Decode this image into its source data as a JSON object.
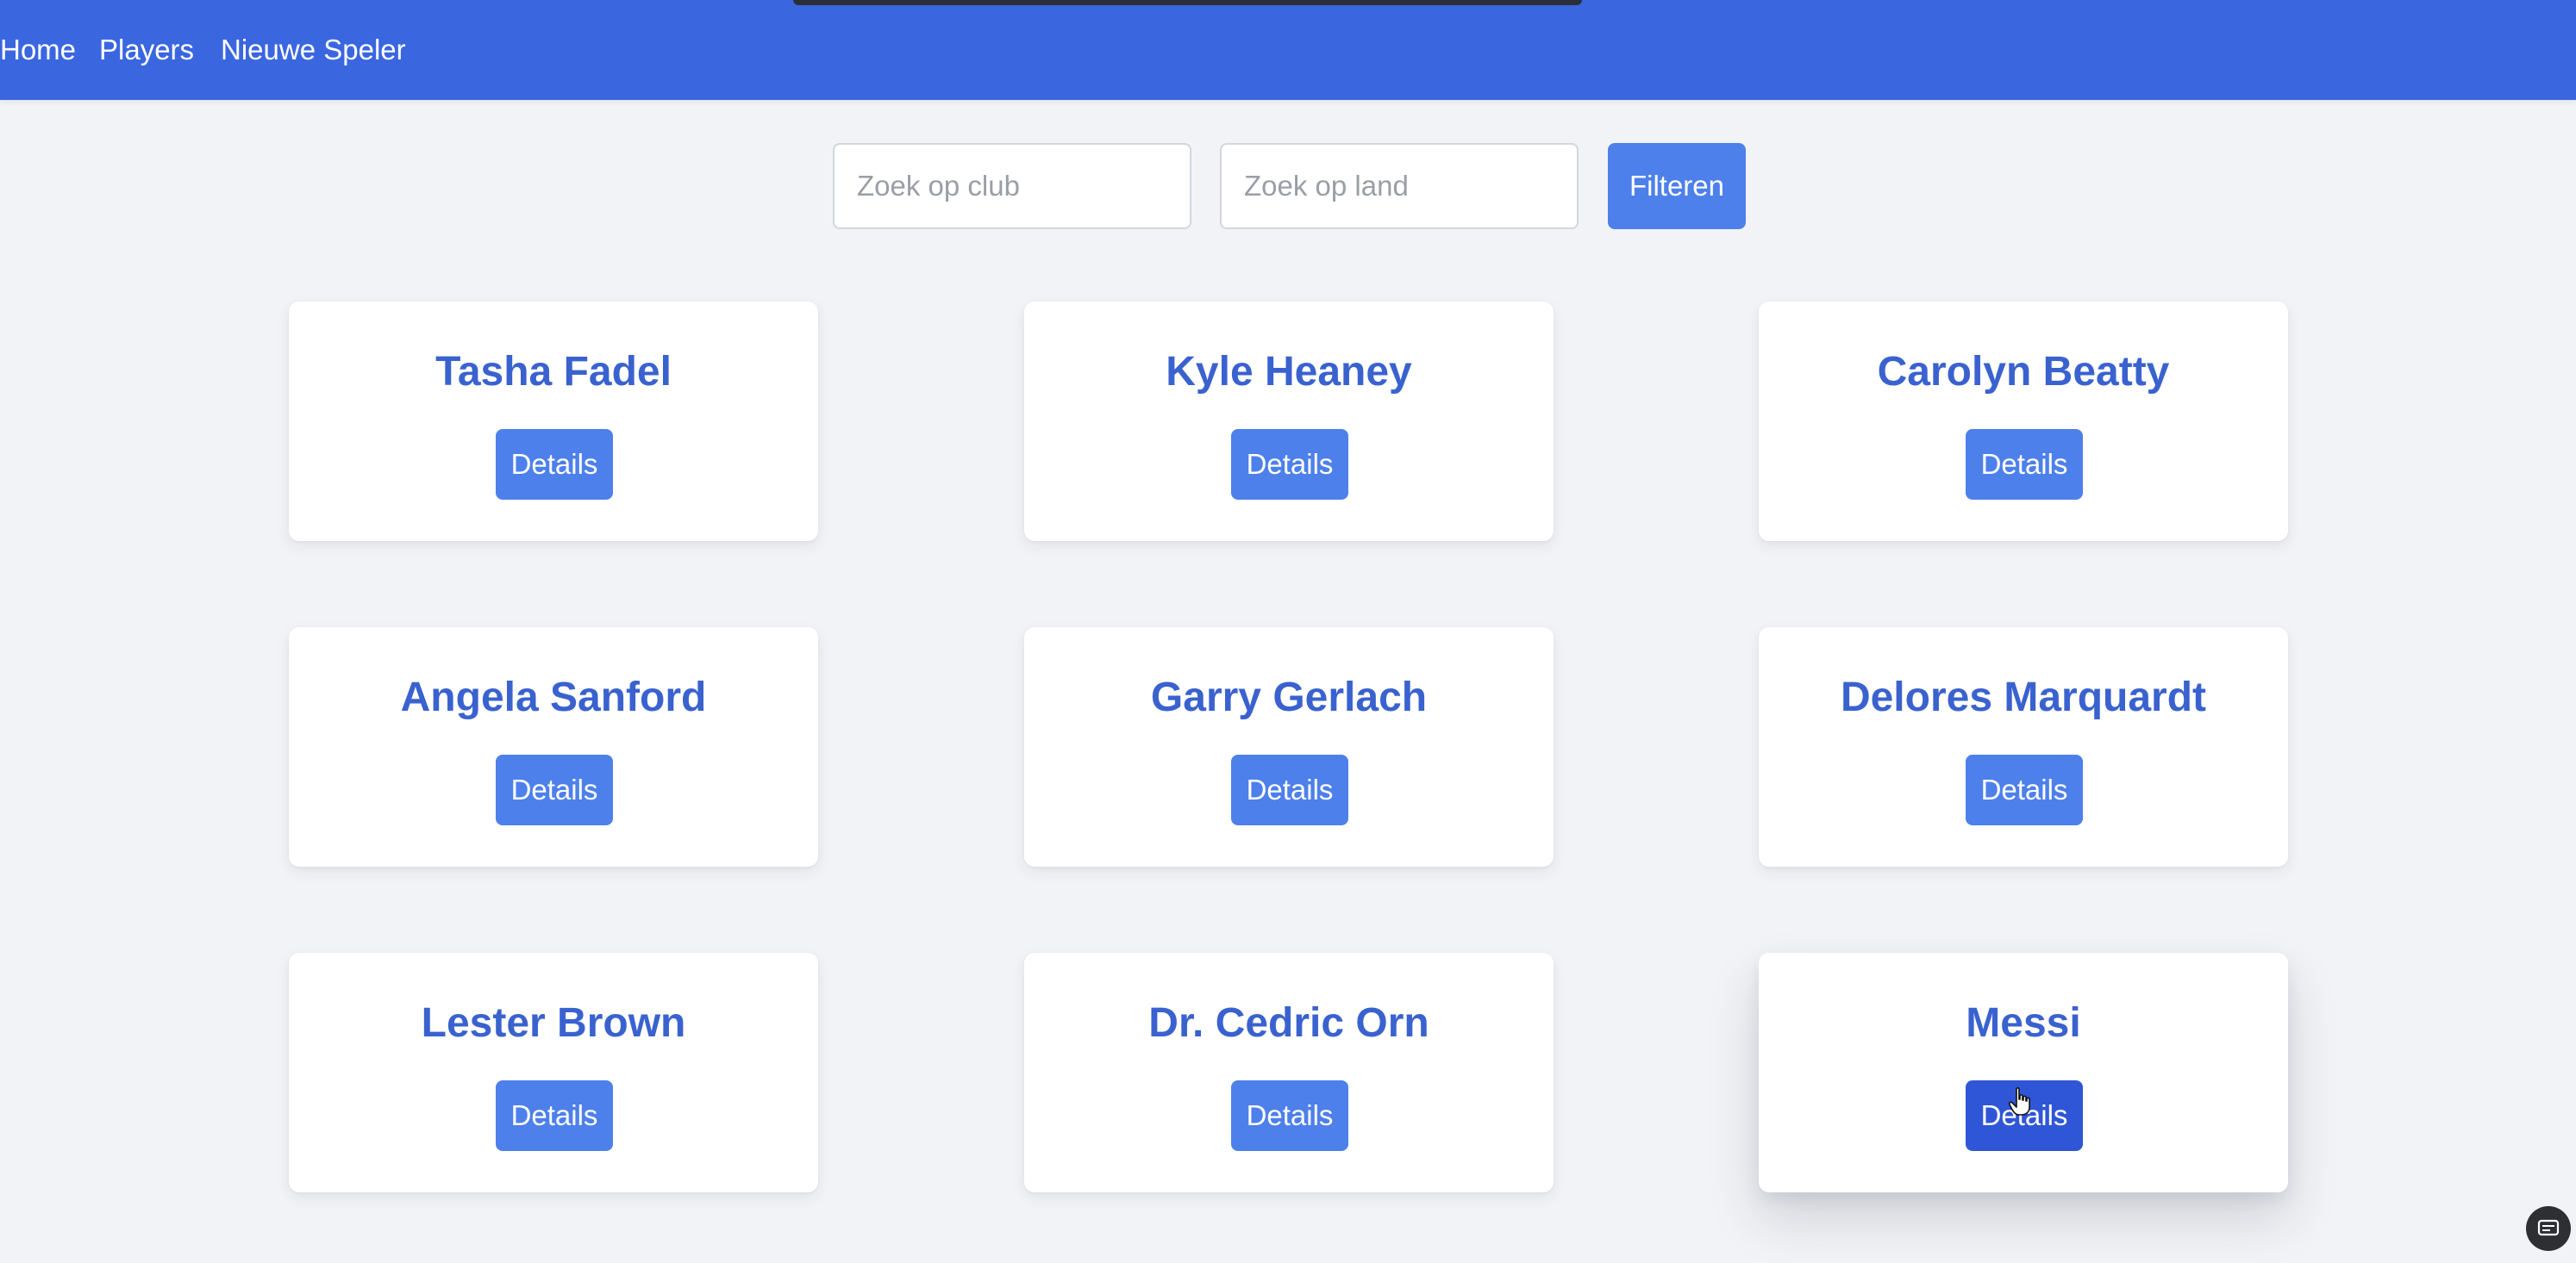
{
  "nav": {
    "links": [
      "Home",
      "Players",
      "Nieuwe Speler"
    ]
  },
  "filters": {
    "club_placeholder": "Zoek op club",
    "country_placeholder": "Zoek op land",
    "filter_label": "Filteren"
  },
  "players": [
    {
      "name": "Tasha Fadel",
      "button": "Details"
    },
    {
      "name": "Kyle Heaney",
      "button": "Details"
    },
    {
      "name": "Carolyn Beatty",
      "button": "Details"
    },
    {
      "name": "Angela Sanford",
      "button": "Details"
    },
    {
      "name": "Garry Gerlach",
      "button": "Details"
    },
    {
      "name": "Delores Marquardt",
      "button": "Details"
    },
    {
      "name": "Lester Brown",
      "button": "Details"
    },
    {
      "name": "Dr. Cedric Orn",
      "button": "Details"
    },
    {
      "name": "Messi",
      "button": "Details"
    }
  ],
  "colors": {
    "navbar": "#3a66e0",
    "accent": "#4d80ea",
    "accent_active": "#2f56d6",
    "player_name": "#3a62cf",
    "background": "#f2f3f6"
  },
  "icons": {
    "cursor": "hand-pointer-icon",
    "corner_widget": "subtitles-icon"
  }
}
